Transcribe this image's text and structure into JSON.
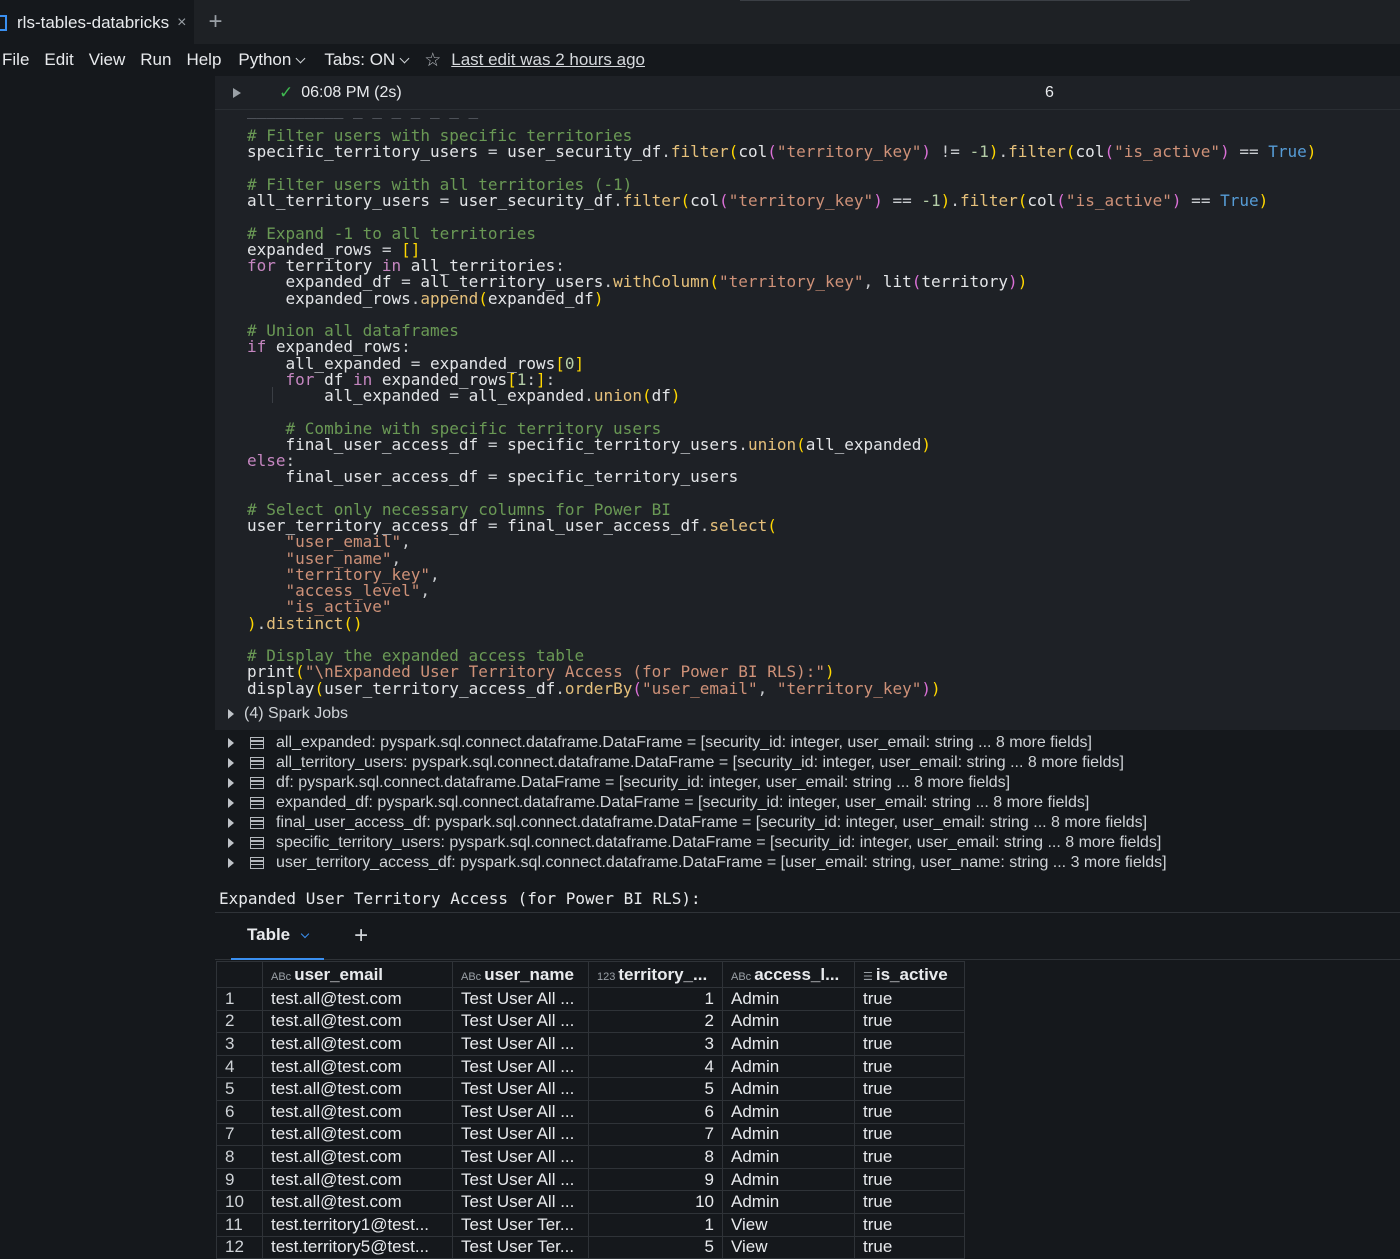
{
  "tab": {
    "title": "rls-tables-databricks",
    "close": "×",
    "add": "+"
  },
  "menu": {
    "items": [
      "File",
      "Edit",
      "View",
      "Run",
      "Help"
    ],
    "language": "Python",
    "tabs_mode": "Tabs: ON",
    "last_edit": "Last edit was 2 hours ago"
  },
  "cell": {
    "status_time": "06:08 PM (2s)",
    "number": "6"
  },
  "spark_jobs": "(4) Spark Jobs",
  "variables": [
    "all_expanded:  pyspark.sql.connect.dataframe.DataFrame = [security_id: integer, user_email: string ... 8 more fields]",
    "all_territory_users:  pyspark.sql.connect.dataframe.DataFrame = [security_id: integer, user_email: string ... 8 more fields]",
    "df:  pyspark.sql.connect.dataframe.DataFrame = [security_id: integer, user_email: string ... 8 more fields]",
    "expanded_df:  pyspark.sql.connect.dataframe.DataFrame = [security_id: integer, user_email: string ... 8 more fields]",
    "final_user_access_df:  pyspark.sql.connect.dataframe.DataFrame = [security_id: integer, user_email: string ... 8 more fields]",
    "specific_territory_users:  pyspark.sql.connect.dataframe.DataFrame = [security_id: integer, user_email: string ... 8 more fields]",
    "user_territory_access_df:  pyspark.sql.connect.dataframe.DataFrame = [user_email: string, user_name: string ... 3 more fields]"
  ],
  "output_title": "Expanded User Territory Access (for Power BI RLS):",
  "table_view": {
    "tab_label": "Table",
    "add": "+"
  },
  "table": {
    "columns": [
      {
        "type": "ABc",
        "label": "user_email"
      },
      {
        "type": "ABc",
        "label": "user_name"
      },
      {
        "type": "123",
        "label": "territory_..."
      },
      {
        "type": "ABc",
        "label": "access_l..."
      },
      {
        "type": "bool",
        "label": "is_active"
      }
    ],
    "rows": [
      [
        "1",
        "test.all@test.com",
        "Test User All ...",
        "1",
        "Admin",
        "true"
      ],
      [
        "2",
        "test.all@test.com",
        "Test User All ...",
        "2",
        "Admin",
        "true"
      ],
      [
        "3",
        "test.all@test.com",
        "Test User All ...",
        "3",
        "Admin",
        "true"
      ],
      [
        "4",
        "test.all@test.com",
        "Test User All ...",
        "4",
        "Admin",
        "true"
      ],
      [
        "5",
        "test.all@test.com",
        "Test User All ...",
        "5",
        "Admin",
        "true"
      ],
      [
        "6",
        "test.all@test.com",
        "Test User All ...",
        "6",
        "Admin",
        "true"
      ],
      [
        "7",
        "test.all@test.com",
        "Test User All ...",
        "7",
        "Admin",
        "true"
      ],
      [
        "8",
        "test.all@test.com",
        "Test User All ...",
        "8",
        "Admin",
        "true"
      ],
      [
        "9",
        "test.all@test.com",
        "Test User All ...",
        "9",
        "Admin",
        "true"
      ],
      [
        "10",
        "test.all@test.com",
        "Test User All ...",
        "10",
        "Admin",
        "true"
      ],
      [
        "11",
        "test.territory1@test...",
        "Test User Ter...",
        "1",
        "View",
        "true"
      ],
      [
        "12",
        "test.territory5@test...",
        "Test User Ter...",
        "5",
        "View",
        "true"
      ]
    ]
  },
  "code_lines": [
    "# Filter users with specific territories",
    "specific_territory_users = user_security_df.filter(col(\"territory_key\") != -1).filter(col(\"is_active\") == True)",
    "",
    "# Filter users with all territories (-1)",
    "all_territory_users = user_security_df.filter(col(\"territory_key\") == -1).filter(col(\"is_active\") == True)",
    "",
    "# Expand -1 to all territories",
    "expanded_rows = []",
    "for territory in all_territories:",
    "    expanded_df = all_territory_users.withColumn(\"territory_key\", lit(territory))",
    "    expanded_rows.append(expanded_df)",
    "",
    "# Union all dataframes",
    "if expanded_rows:",
    "    all_expanded = expanded_rows[0]",
    "    for df in expanded_rows[1:]:",
    "        all_expanded = all_expanded.union(df)",
    "",
    "    # Combine with specific territory users",
    "    final_user_access_df = specific_territory_users.union(all_expanded)",
    "else:",
    "    final_user_access_df = specific_territory_users",
    "",
    "# Select only necessary columns for Power BI",
    "user_territory_access_df = final_user_access_df.select(",
    "    \"user_email\",",
    "    \"user_name\",",
    "    \"territory_key\",",
    "    \"access_level\",",
    "    \"is_active\"",
    ").distinct()",
    "",
    "# Display the expanded access table",
    "print(\"\\nExpanded User Territory Access (for Power BI RLS):\")",
    "display(user_territory_access_df.orderBy(\"user_email\", \"territory_key\"))"
  ]
}
